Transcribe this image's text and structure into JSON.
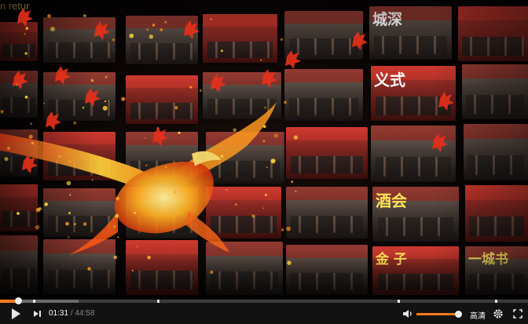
{
  "player": {
    "current_time": "01:31",
    "separator": "/",
    "duration": "44:58",
    "progress_fraction": 0.0337,
    "buffered_fraction": 0.149,
    "chapter_markers_fraction": [
      0.0625,
      0.298,
      0.753,
      0.938
    ],
    "volume_fraction": 0.95,
    "quality_label": "高清",
    "accent_color": "#ff7a1a"
  },
  "video": {
    "tile_texts": [
      {
        "text": "城深",
        "color": "#ffffff"
      },
      {
        "text": "义式",
        "color": "#ffffff"
      },
      {
        "text": "酒会",
        "color": "#ffe25a"
      },
      {
        "text": "n retur",
        "color": "#ffe25a"
      },
      {
        "text": "金 子",
        "color": "#ffe25a"
      },
      {
        "text": "一城书",
        "color": "#ffe25a"
      }
    ]
  },
  "icons": {
    "play": "play-icon",
    "next": "next-icon",
    "volume": "volume-icon",
    "settings": "gear-icon",
    "fullscreen": "fullscreen-icon"
  }
}
